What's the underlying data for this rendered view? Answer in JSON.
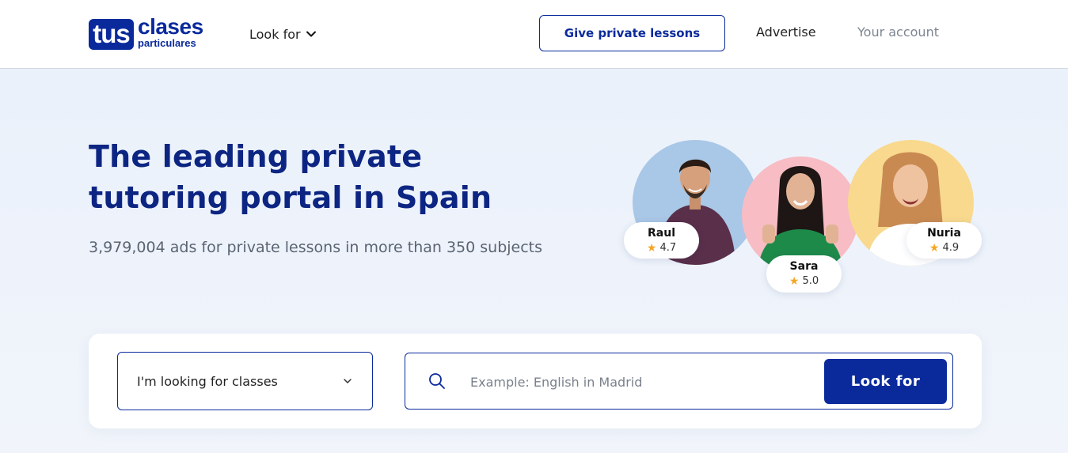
{
  "header": {
    "logo": {
      "mark": "tus",
      "word1": "clases",
      "word2": "particulares"
    },
    "nav_lookfor_label": "Look for",
    "give_lessons_label": "Give private lessons",
    "advertise_label": "Advertise",
    "account_label": "Your account"
  },
  "hero": {
    "title": "The leading private tutoring portal in Spain",
    "subtitle": "3,979,004 ads for private lessons in more than 350 subjects"
  },
  "tutors": [
    {
      "name": "Raul",
      "rating": "4.7",
      "color": "#a9c7e6"
    },
    {
      "name": "Sara",
      "rating": "5.0",
      "color": "#f7bcc4"
    },
    {
      "name": "Nuria",
      "rating": "4.9",
      "color": "#f8d98e"
    }
  ],
  "search": {
    "select_value": "I'm looking for classes",
    "input_placeholder": "Example: English in Madrid",
    "input_value": "",
    "button_label": "Look for"
  },
  "colors": {
    "brand": "#0a2a9c",
    "title": "#0d2582",
    "star": "#f4a623"
  },
  "icons": [
    "chevron-down-icon",
    "search-icon",
    "star-icon"
  ]
}
